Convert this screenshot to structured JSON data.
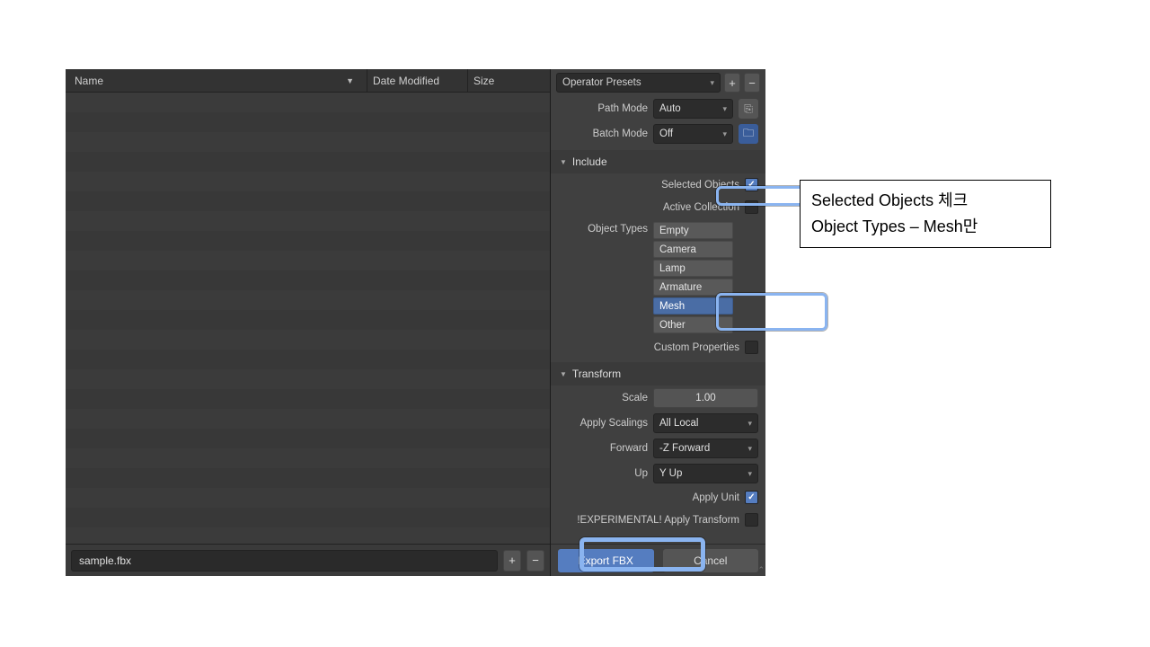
{
  "browser": {
    "columns": {
      "name": "Name",
      "date": "Date Modified",
      "size": "Size"
    },
    "filename": "sample.fbx"
  },
  "panel": {
    "presets_label": "Operator Presets",
    "path_mode": {
      "label": "Path Mode",
      "value": "Auto"
    },
    "batch_mode": {
      "label": "Batch Mode",
      "value": "Off"
    },
    "sections": {
      "include": "Include",
      "transform": "Transform"
    },
    "include": {
      "selected_objects": "Selected Objects",
      "active_collection": "Active Collection",
      "object_types_label": "Object Types",
      "types": [
        {
          "name": "Empty",
          "selected": false
        },
        {
          "name": "Camera",
          "selected": false
        },
        {
          "name": "Lamp",
          "selected": false
        },
        {
          "name": "Armature",
          "selected": false
        },
        {
          "name": "Mesh",
          "selected": true
        },
        {
          "name": "Other",
          "selected": false
        }
      ],
      "custom_properties": "Custom Properties"
    },
    "transform": {
      "scale": {
        "label": "Scale",
        "value": "1.00"
      },
      "apply_scalings": {
        "label": "Apply Scalings",
        "value": "All Local"
      },
      "forward": {
        "label": "Forward",
        "value": "-Z Forward"
      },
      "up": {
        "label": "Up",
        "value": "Y Up"
      },
      "apply_unit": "Apply Unit",
      "apply_transform": "!EXPERIMENTAL! Apply Transform"
    },
    "actions": {
      "export": "Export FBX",
      "cancel": "Cancel"
    }
  },
  "annotation": {
    "line1": "Selected Objects 체크",
    "line2": "Object Types – Mesh만"
  }
}
